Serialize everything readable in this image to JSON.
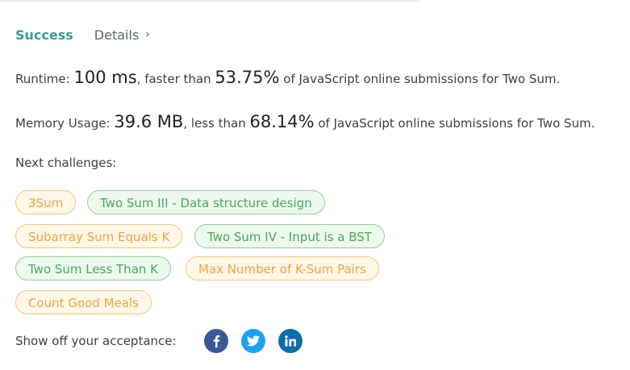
{
  "header": {
    "status": "Success",
    "details_label": "Details",
    "details_chevron": "›"
  },
  "runtime": {
    "label": "Runtime:",
    "value": "100 ms",
    "comparison": ", faster than",
    "percent": "53.75%",
    "suffix": "of JavaScript online submissions for Two Sum."
  },
  "memory": {
    "label": "Memory Usage:",
    "value": "39.6 MB",
    "comparison": ", less than",
    "percent": "68.14%",
    "suffix": "of JavaScript online submissions for Two Sum."
  },
  "next_challenges": {
    "label": "Next challenges:",
    "items": [
      {
        "label": "3Sum",
        "difficulty": "medium"
      },
      {
        "label": "Two Sum III - Data structure design",
        "difficulty": "easy"
      },
      {
        "label": "Subarray Sum Equals K",
        "difficulty": "medium"
      },
      {
        "label": "Two Sum IV - Input is a BST",
        "difficulty": "easy"
      },
      {
        "label": "Two Sum Less Than K",
        "difficulty": "easy"
      },
      {
        "label": "Max Number of K-Sum Pairs",
        "difficulty": "medium"
      },
      {
        "label": "Count Good Meals",
        "difficulty": "medium"
      }
    ]
  },
  "share": {
    "label": "Show off your acceptance:",
    "icons": [
      "facebook-icon",
      "twitter-icon",
      "linkedin-icon"
    ]
  },
  "colors": {
    "success": "#3e9b8c",
    "medium_text": "#f0a33c",
    "medium_border": "#f3c57a",
    "medium_bg": "#fff7e8",
    "easy_text": "#49a85a",
    "easy_border": "#8fd19a",
    "easy_bg": "#edf8ee",
    "facebook": "#3b5998",
    "twitter": "#1da1f2",
    "linkedin": "#0e6ea6"
  }
}
